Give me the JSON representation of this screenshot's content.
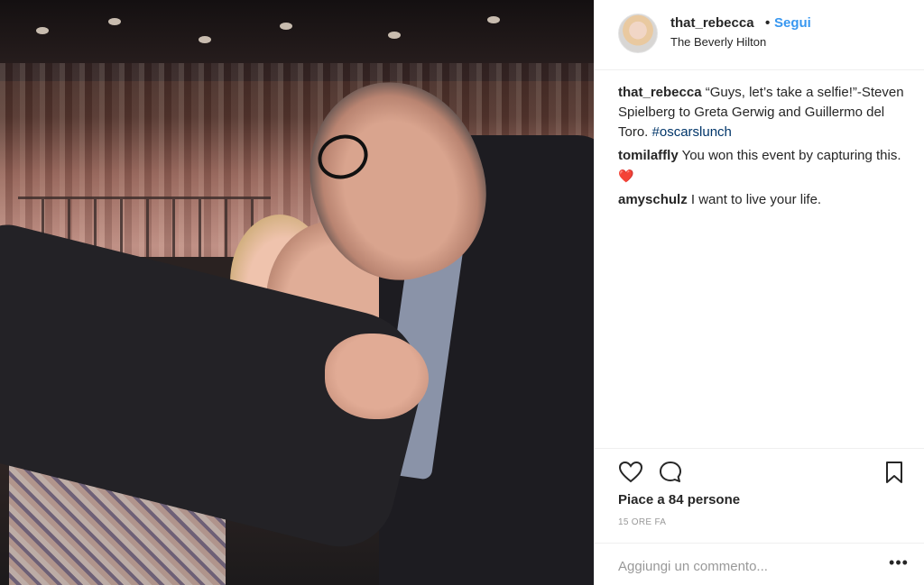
{
  "post": {
    "photo_icon": "selfie-photo"
  },
  "header": {
    "username": "that_rebecca",
    "separator": "•",
    "follow_label": "Segui",
    "location": "The Beverly Hilton"
  },
  "comments": [
    {
      "author": "that_rebecca",
      "text": " “Guys, let’s take a selfie!”-Steven Spielberg to Greta Gerwig and Guillermo del Toro. ",
      "hashtag": "#oscarslunch"
    },
    {
      "author": "tomilaffly",
      "text": " You won this event by capturing this. ",
      "emoji": "❤️"
    },
    {
      "author": "amyschulz",
      "text": " I want to live your life."
    }
  ],
  "actions": {
    "like_icon": "heart-outline-icon",
    "comment_icon": "comment-bubble-icon",
    "save_icon": "bookmark-icon",
    "likes": "Piace a 84 persone",
    "time": "15 ORE FA"
  },
  "add_comment": {
    "placeholder": "Aggiungi un commento...",
    "more_label": "•••"
  },
  "colors": {
    "link_blue": "#3897f0",
    "hashtag": "#003569",
    "muted": "#999999",
    "text": "#262626",
    "border": "#efefef"
  }
}
